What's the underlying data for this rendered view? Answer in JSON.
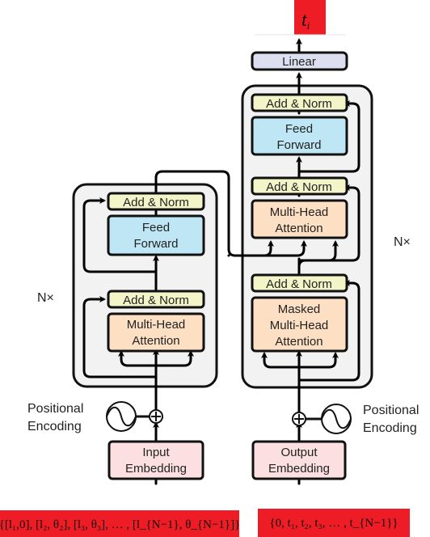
{
  "colors": {
    "add_norm": "#f3f5c8",
    "feed_forward": "#bfe6f5",
    "attention": "#fde0c4",
    "embedding": "#fcdfe0",
    "linear": "#dcdff0",
    "stack_bg": "#f2f2f2",
    "label_red": "#ee1c25"
  },
  "output": {
    "label_main": "t",
    "label_sub": "i"
  },
  "decoder": {
    "linear": "Linear",
    "add_norm_top": "Add & Norm",
    "feed_forward_l1": "Feed",
    "feed_forward_l2": "Forward",
    "add_norm_mid": "Add & Norm",
    "cross_attention_l1": "Multi-Head",
    "cross_attention_l2": "Attention",
    "add_norm_bottom": "Add & Norm",
    "masked_attention_l1": "Masked",
    "masked_attention_l2": "Multi-Head",
    "masked_attention_l3": "Attention",
    "repeat": "N×",
    "embedding_l1": "Output",
    "embedding_l2": "Embedding",
    "pos_enc_l1": "Positional",
    "pos_enc_l2": "Encoding",
    "input_label": "{0, t₁, t₂, t₃, … , t_{N−1}}"
  },
  "encoder": {
    "add_norm_top": "Add & Norm",
    "feed_forward_l1": "Feed",
    "feed_forward_l2": "Forward",
    "add_norm_bottom": "Add & Norm",
    "attention_l1": "Multi-Head",
    "attention_l2": "Attention",
    "repeat": "N×",
    "embedding_l1": "Input",
    "embedding_l2": "Embedding",
    "pos_enc_l1": "Positional",
    "pos_enc_l2": "Encoding",
    "input_label": "{[l₁,0], [l₂, θ₂], [l₃, θ₃], … , [l_{N−1}, θ_{N−1}]}"
  }
}
